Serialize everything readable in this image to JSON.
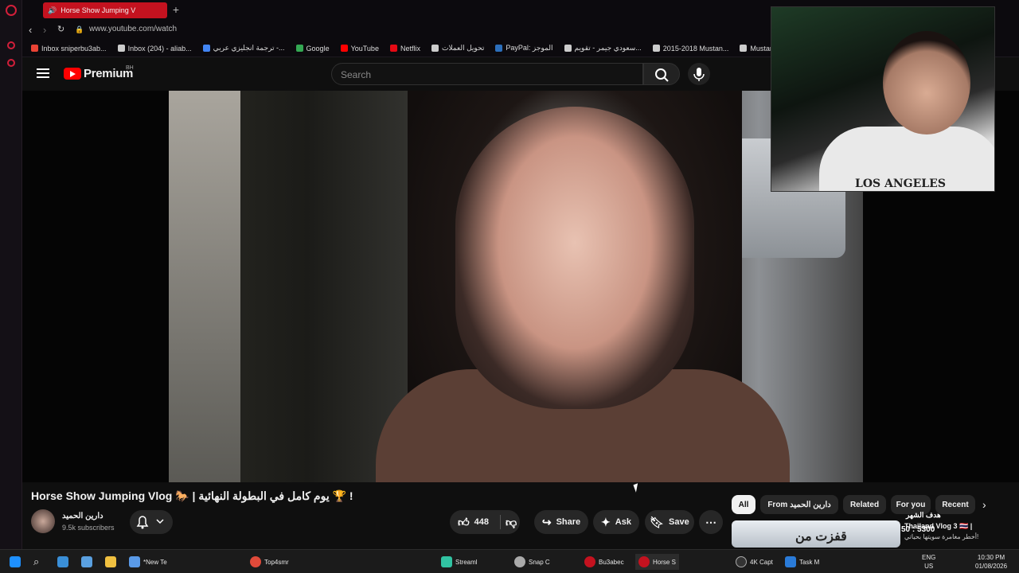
{
  "browser": {
    "tab_title": "Horse Show Jumping V",
    "url": "www.youtube.com/watch"
  },
  "bookmarks": [
    {
      "label": "Inbox sniperbu3ab...",
      "color": "#ea4335"
    },
    {
      "label": "Inbox (204) - aliab...",
      "color": "#cccccc"
    },
    {
      "label": "ترجمة انجليزي عربي -...",
      "color": "#4285f4"
    },
    {
      "label": "Google",
      "color": "#34a853"
    },
    {
      "label": "YouTube",
      "color": "#ff0000"
    },
    {
      "label": "Netflix",
      "color": "#e50914"
    },
    {
      "label": "تحويل العملات",
      "color": "#cccccc"
    },
    {
      "label": "PayPal: الموجز",
      "color": "#2c6fbb"
    },
    {
      "label": "سعودي جيمر - تقويم...",
      "color": "#cccccc"
    },
    {
      "label": "2015-2018 Mustan...",
      "color": "#cccccc"
    },
    {
      "label": "Mustang Seat Belt...",
      "color": "#cccccc"
    }
  ],
  "youtube": {
    "logo_text": "Premium",
    "region": "BH",
    "search_placeholder": "Search"
  },
  "video": {
    "title": "Horse Show Jumping Vlog 🐎 | يوم كامل في البطولة النهائية 🏆 !",
    "channel_name": "دارين الحميد",
    "subscribers": "9.5k subscribers",
    "likes": "448",
    "share_label": "Share",
    "ask_label": "Ask",
    "save_label": "Save"
  },
  "webcam_overlay": {
    "shirt_text": "LOS ANGELES"
  },
  "chips": [
    "All",
    "From دارين الحميد",
    "Related",
    "For you",
    "Recent"
  ],
  "recommended": {
    "thumb_text": "قفزت من",
    "title": "Thailand Vlog 3 🇹🇭 |",
    "subtitle": "أخطر مغامرة سويتها بحياتي!"
  },
  "stream_goal": {
    "label": "هدف الشهر",
    "value": "50 : 5300"
  },
  "taskbar": {
    "items": [
      "*New Te",
      "Top4smr",
      "Streaml",
      "Snap C",
      "Bu3abec",
      "Horse S",
      "4K Capt",
      "Task M"
    ],
    "language": "ENG",
    "region": "US",
    "time": "10:30 PM",
    "date": "01/08/2026"
  },
  "colors": {
    "accent": "#ff0000",
    "opera_red": "#c4121f",
    "background": "#0f0f0f"
  }
}
